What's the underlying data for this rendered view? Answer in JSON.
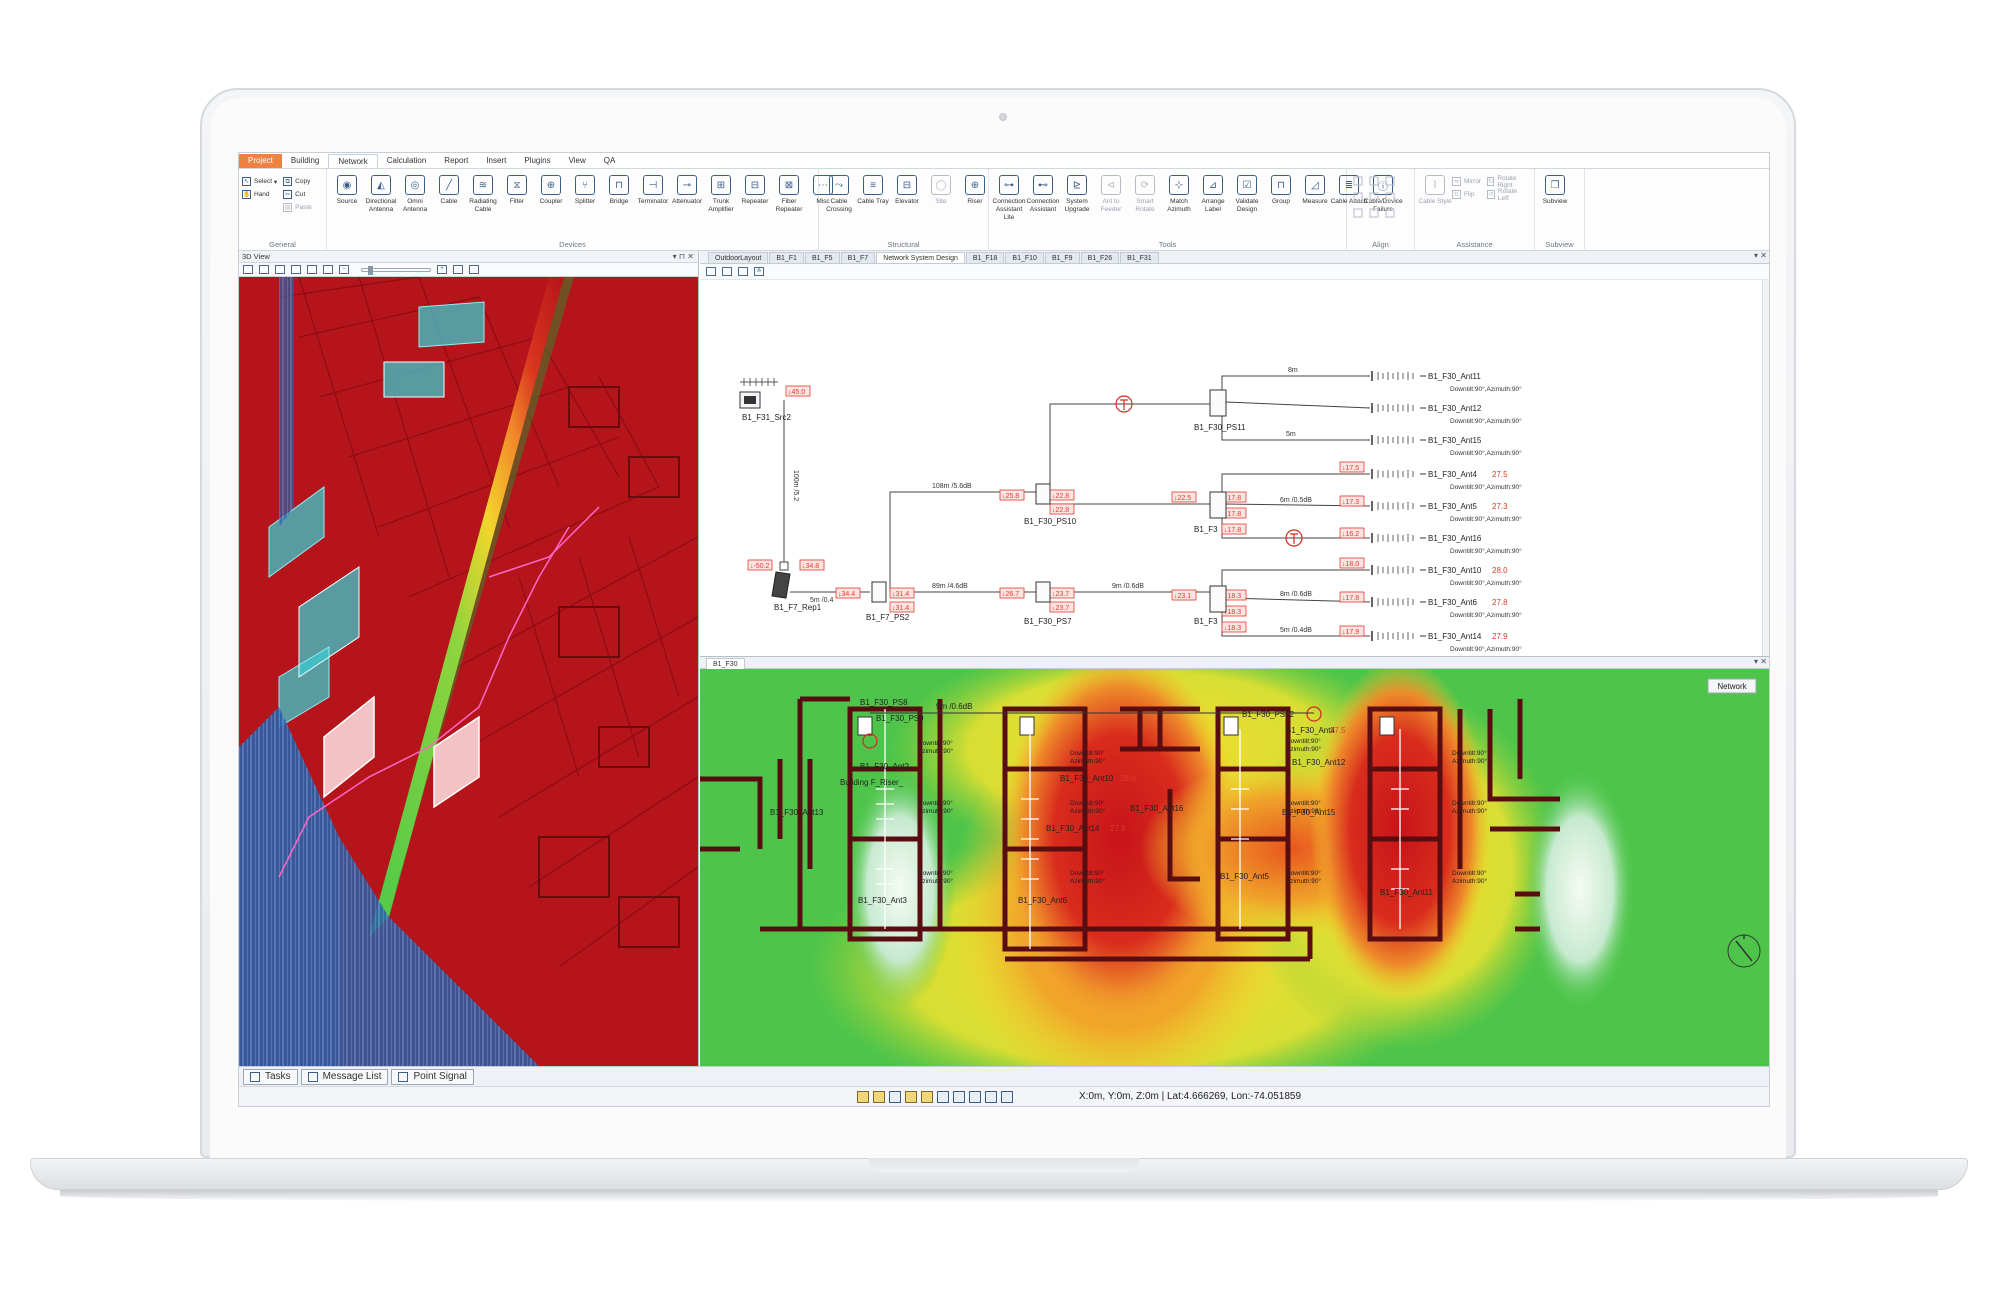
{
  "ribbon": {
    "tabs": [
      "Project",
      "Building",
      "Network",
      "Calculation",
      "Report",
      "Insert",
      "Plugins",
      "View",
      "QA"
    ],
    "active_tab": "Project",
    "selected_tab": "Network",
    "general": {
      "label": "General",
      "select": "Select",
      "hand": "Hand",
      "copy": "Copy",
      "cut": "Cut",
      "paste": "Paste"
    },
    "devices": {
      "label": "Devices",
      "buttons": [
        "Source",
        "Directional Antenna",
        "Omni Antenna",
        "Cable",
        "Radiating Cable",
        "Filter",
        "Coupler",
        "Splitter",
        "Bridge",
        "Terminator",
        "Attenuator",
        "Trunk Amplifier",
        "Repeater",
        "Fiber Repeater",
        "Misc"
      ]
    },
    "structural": {
      "label": "Structural",
      "buttons": [
        "Cable Crossing",
        "Cable Tray",
        "Elevator",
        "Site",
        "Riser"
      ]
    },
    "tools": {
      "label": "Tools",
      "buttons": [
        "Connection Assistant Lite",
        "Connection Assistant",
        "System Upgrade",
        "Ant to Feeder",
        "Smart Rotate",
        "Match Azimuth",
        "Arrange Label",
        "Validate Design",
        "Group",
        "Measure",
        "Cable Attach",
        "Cable/Device Failure"
      ]
    },
    "align": {
      "label": "Align"
    },
    "assistance": {
      "label": "Assistance",
      "cable_style": "Cable Style",
      "mirror": "Mirror",
      "flip": "Flip",
      "rotate_right": "Rotate Right",
      "rotate_left": "Rotate Left"
    },
    "subview": {
      "label": "Subview",
      "button": "Subview"
    }
  },
  "view3d": {
    "title": "3D View"
  },
  "doc_tabs": [
    "OutdoorLayout",
    "B1_F1",
    "B1_F5",
    "B1_F7",
    "Network System Design",
    "B1_F18",
    "B1_F10",
    "B1_F9",
    "B1_F26",
    "B1_F31"
  ],
  "doc_tab_active": "Network System Design",
  "nsd": {
    "source": "B1_F31_Src2",
    "repeater": "B1_F7_Rep1",
    "splitters": [
      "B1_F7_PS2",
      "B1_F30_PS10",
      "B1_F30_PS7",
      "B1_F30_PS11",
      "B1_F3",
      "B1_F3"
    ],
    "antennas": [
      {
        "name": "B1_F30_Ant11",
        "detail": "Downtilt:90°,Azimuth:90°",
        "value": ""
      },
      {
        "name": "B1_F30_Ant12",
        "detail": "Downtilt:90°,Azimuth:90°",
        "value": ""
      },
      {
        "name": "B1_F30_Ant15",
        "detail": "Downtilt:90°,Azimuth:90°",
        "value": ""
      },
      {
        "name": "B1_F30_Ant4",
        "detail": "Downtilt:90°,Azimuth:90°",
        "value": "27.5"
      },
      {
        "name": "B1_F30_Ant5",
        "detail": "Downtilt:90°,Azimuth:90°",
        "value": "27.3"
      },
      {
        "name": "B1_F30_Ant16",
        "detail": "Downtilt:90°,Azimuth:90°",
        "value": ""
      },
      {
        "name": "B1_F30_Ant10",
        "detail": "Downtilt:90°,Azimuth:90°",
        "value": "28.0"
      },
      {
        "name": "B1_F30_Ant6",
        "detail": "Downtilt:90°,Azimuth:90°",
        "value": "27.8"
      },
      {
        "name": "B1_F30_Ant14",
        "detail": "Downtilt:90°,Azimuth:90°",
        "value": "27.9"
      }
    ],
    "cable_labels": [
      "8m",
      "5m",
      "108m /5.6dB",
      "89m /4.6dB",
      "9m /0.6dB",
      "6m /0.5dB",
      "8m /0.6dB",
      "5m /0.4dB",
      "5m /0.4",
      "100m /5.2"
    ],
    "level_tags": [
      "↓45.0",
      "↓-50.2",
      "↓34.8",
      "↓34.4",
      "↓31.4",
      "↓31.4",
      "↓25.8",
      "↓22.8",
      "↓22.8",
      "↓26.7",
      "↓23.7",
      "↓23.7",
      "↓22.5",
      "↓17.8",
      "↓17.8",
      "↓17.8",
      "↓17.5",
      "↓17.3",
      "↓16.2",
      "↓23.1",
      "↓18.3",
      "↓18.3",
      "↓18.3",
      "↓18.0",
      "↓17.8",
      "↓17.9"
    ]
  },
  "floor": {
    "tab": "B1_F30",
    "legend": "Network",
    "labels": [
      "9m /0.6dB",
      "B1_F30_PS8",
      "B1_F30_PS9",
      "B1_F30_PS12",
      "B1_F30_Ant2",
      "B1_F30_Ant4",
      "27.5",
      "B1_F30_Ant12",
      "B1_F30_Ant13",
      "B1_F30_Ant10",
      "28.0",
      "B1_F30_Ant14",
      "27.9",
      "B1_F30_Ant16",
      "B1_F30_Ant15",
      "B1_F30_Ant3",
      "B1_F30_Ant6",
      "B1_F30_Ant5",
      "B1_F30_Ant11",
      "Building F_Riser_"
    ],
    "detail_lines": [
      "Downtilt:90°",
      "Azimuth:90°"
    ]
  },
  "bottom_tabs": [
    "Tasks",
    "Message List",
    "Point Signal"
  ],
  "status": {
    "coords": "X:0m, Y:0m, Z:0m | Lat:4.666269, Lon:-74.051859"
  },
  "colors": {
    "accent": "#f08140",
    "heat_red": "#b5141a",
    "heat_green": "#4ec54a",
    "heat_yellow": "#f3d42a",
    "wall": "#5a0d10",
    "tag_red": "#e03a2e"
  }
}
